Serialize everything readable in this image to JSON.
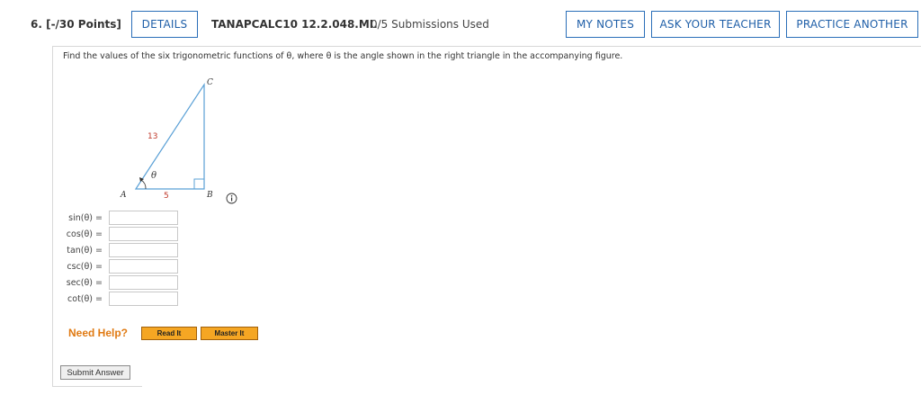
{
  "header": {
    "question_number": "6. [-/30 Points]",
    "details_label": "DETAILS",
    "problem_code": "TANAPCALC10 12.2.048.MI.",
    "submissions": "0/5 Submissions Used",
    "my_notes_label": "MY NOTES",
    "ask_teacher_label": "ASK YOUR TEACHER",
    "practice_another_label": "PRACTICE ANOTHER"
  },
  "question": {
    "prompt": "Find the values of the six trigonometric functions of θ, where θ is the angle shown in the right triangle in the accompanying figure."
  },
  "figure": {
    "vertex_a": "A",
    "vertex_b": "B",
    "vertex_c": "C",
    "hypotenuse_label": "13",
    "base_label": "5",
    "angle_label": "θ",
    "triangle_color": "#5aa0d6",
    "number_color": "#c0392b"
  },
  "answers": [
    {
      "fn": "sin(θ) =",
      "value": ""
    },
    {
      "fn": "cos(θ) =",
      "value": ""
    },
    {
      "fn": "tan(θ) =",
      "value": ""
    },
    {
      "fn": "csc(θ) =",
      "value": ""
    },
    {
      "fn": "sec(θ) =",
      "value": ""
    },
    {
      "fn": "cot(θ) =",
      "value": ""
    }
  ],
  "help": {
    "need_help_label": "Need Help?",
    "read_it_label": "Read It",
    "master_it_label": "Master It"
  },
  "submit_label": "Submit Answer"
}
